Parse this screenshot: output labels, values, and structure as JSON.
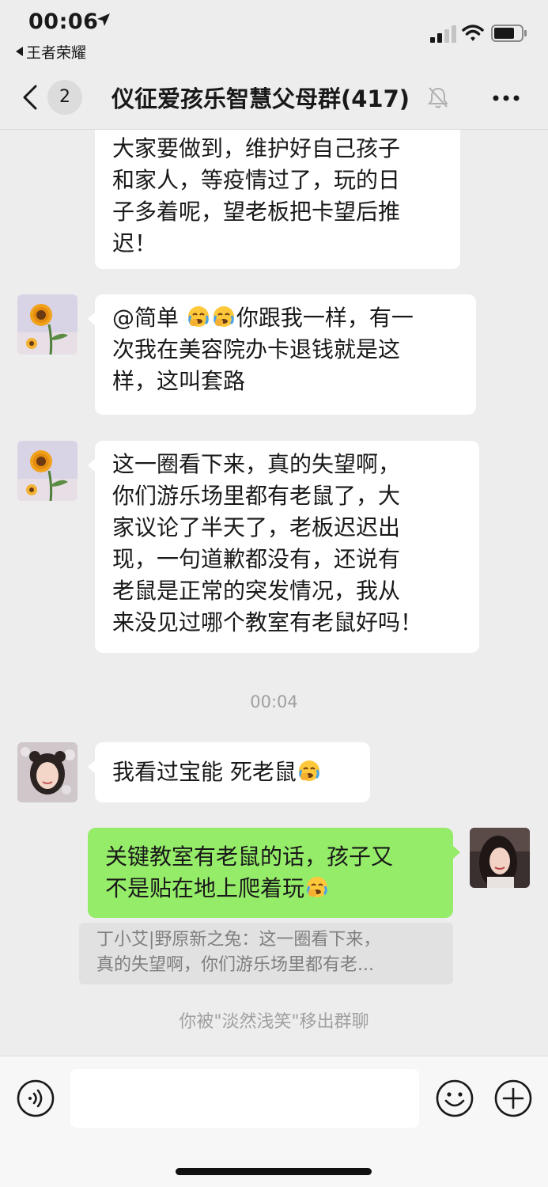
{
  "status_bar": {
    "time": "00:06",
    "back_app": "王者荣耀"
  },
  "header": {
    "unread_count": "2",
    "title": "仪征爱孩乐智慧父母群(417)"
  },
  "messages": [
    {
      "side": "left",
      "lines": [
        "大家要做到，维护好自己孩子",
        "和家人，等疫情过了，玩的日",
        "子多着呢，望老板把卡望后推",
        "迟！"
      ]
    },
    {
      "side": "left",
      "sender_avatar": "sunflower-avatar",
      "line1_prefix": "@简单 ",
      "line1_suffix": "你跟我一样，有一",
      "lines_rest": [
        "次我在美容院办卡退钱就是这",
        "样，这叫套路"
      ]
    },
    {
      "side": "left",
      "sender_avatar": "sunflower-avatar",
      "lines": [
        "这一圈看下来，真的失望啊，",
        "你们游乐场里都有老鼠了，大",
        "家议论了半天了，老板迟迟出",
        "现，一句道歉都没有，还说有",
        "老鼠是正常的突发情况，我从",
        "来没见过哪个教室有老鼠好吗！"
      ]
    },
    {
      "side": "left",
      "sender_avatar": "girl-avatar",
      "text": "我看过宝能 死老鼠"
    },
    {
      "side": "right",
      "sender_avatar": "self-avatar",
      "line1": "关键教室有老鼠的话，孩子又",
      "line2": "不是贴在地上爬着玩"
    }
  ],
  "timestamp": "00:04",
  "quote": {
    "line1": "丁小艾|野原新之兔：这一圈看下来，",
    "line2": "真的失望啊，你们游乐场里都有老..."
  },
  "system_message": "你被\"淡然浅笑\"移出群聊",
  "colors": {
    "background": "#ededed",
    "bubble_self": "#95ec69",
    "bubble_other": "#ffffff"
  },
  "icons": [
    "location-arrow-icon",
    "back-arrow-icon",
    "signal-icon",
    "wifi-icon",
    "battery-icon",
    "chevron-left-icon",
    "mute-bell-icon",
    "more-icon",
    "voice-icon",
    "emoji-icon",
    "plus-icon",
    "facepalm-cry-emoji"
  ]
}
